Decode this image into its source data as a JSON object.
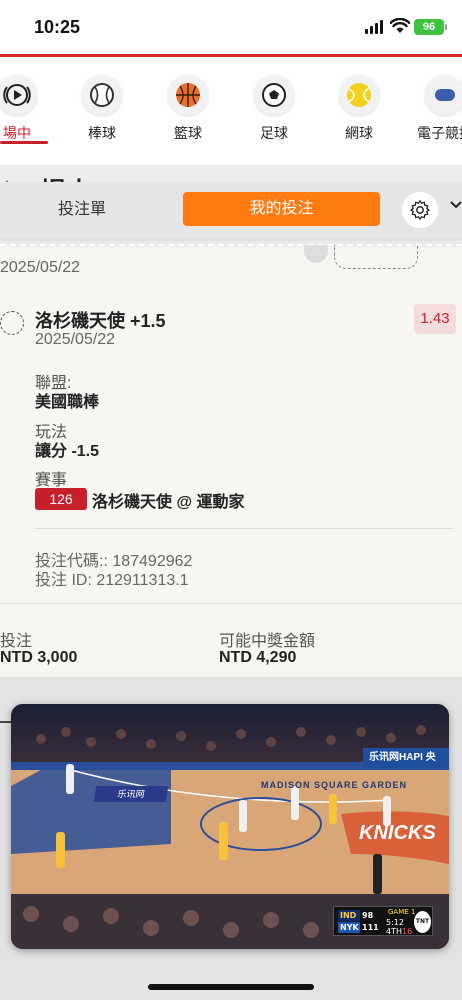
{
  "status": {
    "time": "10:25",
    "battery": "96"
  },
  "sports": [
    {
      "label": "場中",
      "icon": "live-icon"
    },
    {
      "label": "棒球",
      "icon": "baseball-icon"
    },
    {
      "label": "籃球",
      "icon": "basketball-icon"
    },
    {
      "label": "足球",
      "icon": "soccer-icon"
    },
    {
      "label": "網球",
      "icon": "tennis-icon"
    },
    {
      "label": "電子競技",
      "icon": "esports-icon"
    }
  ],
  "background_title": "場中",
  "tabs": {
    "slip": "投注單",
    "mine": "我的投注"
  },
  "bet": {
    "prev_date": "2025/05/22",
    "selection": "洛杉磯天使 +1.5",
    "odds": "1.43",
    "date": "2025/05/22",
    "league_label": "聯盟:",
    "league": "美國職棒",
    "market_label": "玩法",
    "market": "讓分 -1.5",
    "event_label": "賽事",
    "event_id": "126",
    "event": "洛杉磯天使 @ 運動家",
    "bet_code": "投注代碼:: 187492962",
    "bet_id": "投注 ID: 212911313.1",
    "stake_label": "投注",
    "stake": "NTD 3,000",
    "payout_label": "可能中獎金額",
    "payout": "NTD 4,290"
  },
  "video": {
    "ad_top": "乐讯网HAPI 央",
    "ad_floor": "乐讯网",
    "floor_text": "MADISON SQUARE GARDEN",
    "scorebug": {
      "team1": "IND",
      "score1": "98",
      "team2": "NYK",
      "score2": "111",
      "clock": "5:12",
      "quarter": "4TH",
      "shot": "16",
      "game": "GAME 1",
      "network": "TNT"
    }
  },
  "colors": {
    "accent": "#ff7a0f",
    "brand_red": "#c8202a",
    "battery": "#3ec33e"
  }
}
